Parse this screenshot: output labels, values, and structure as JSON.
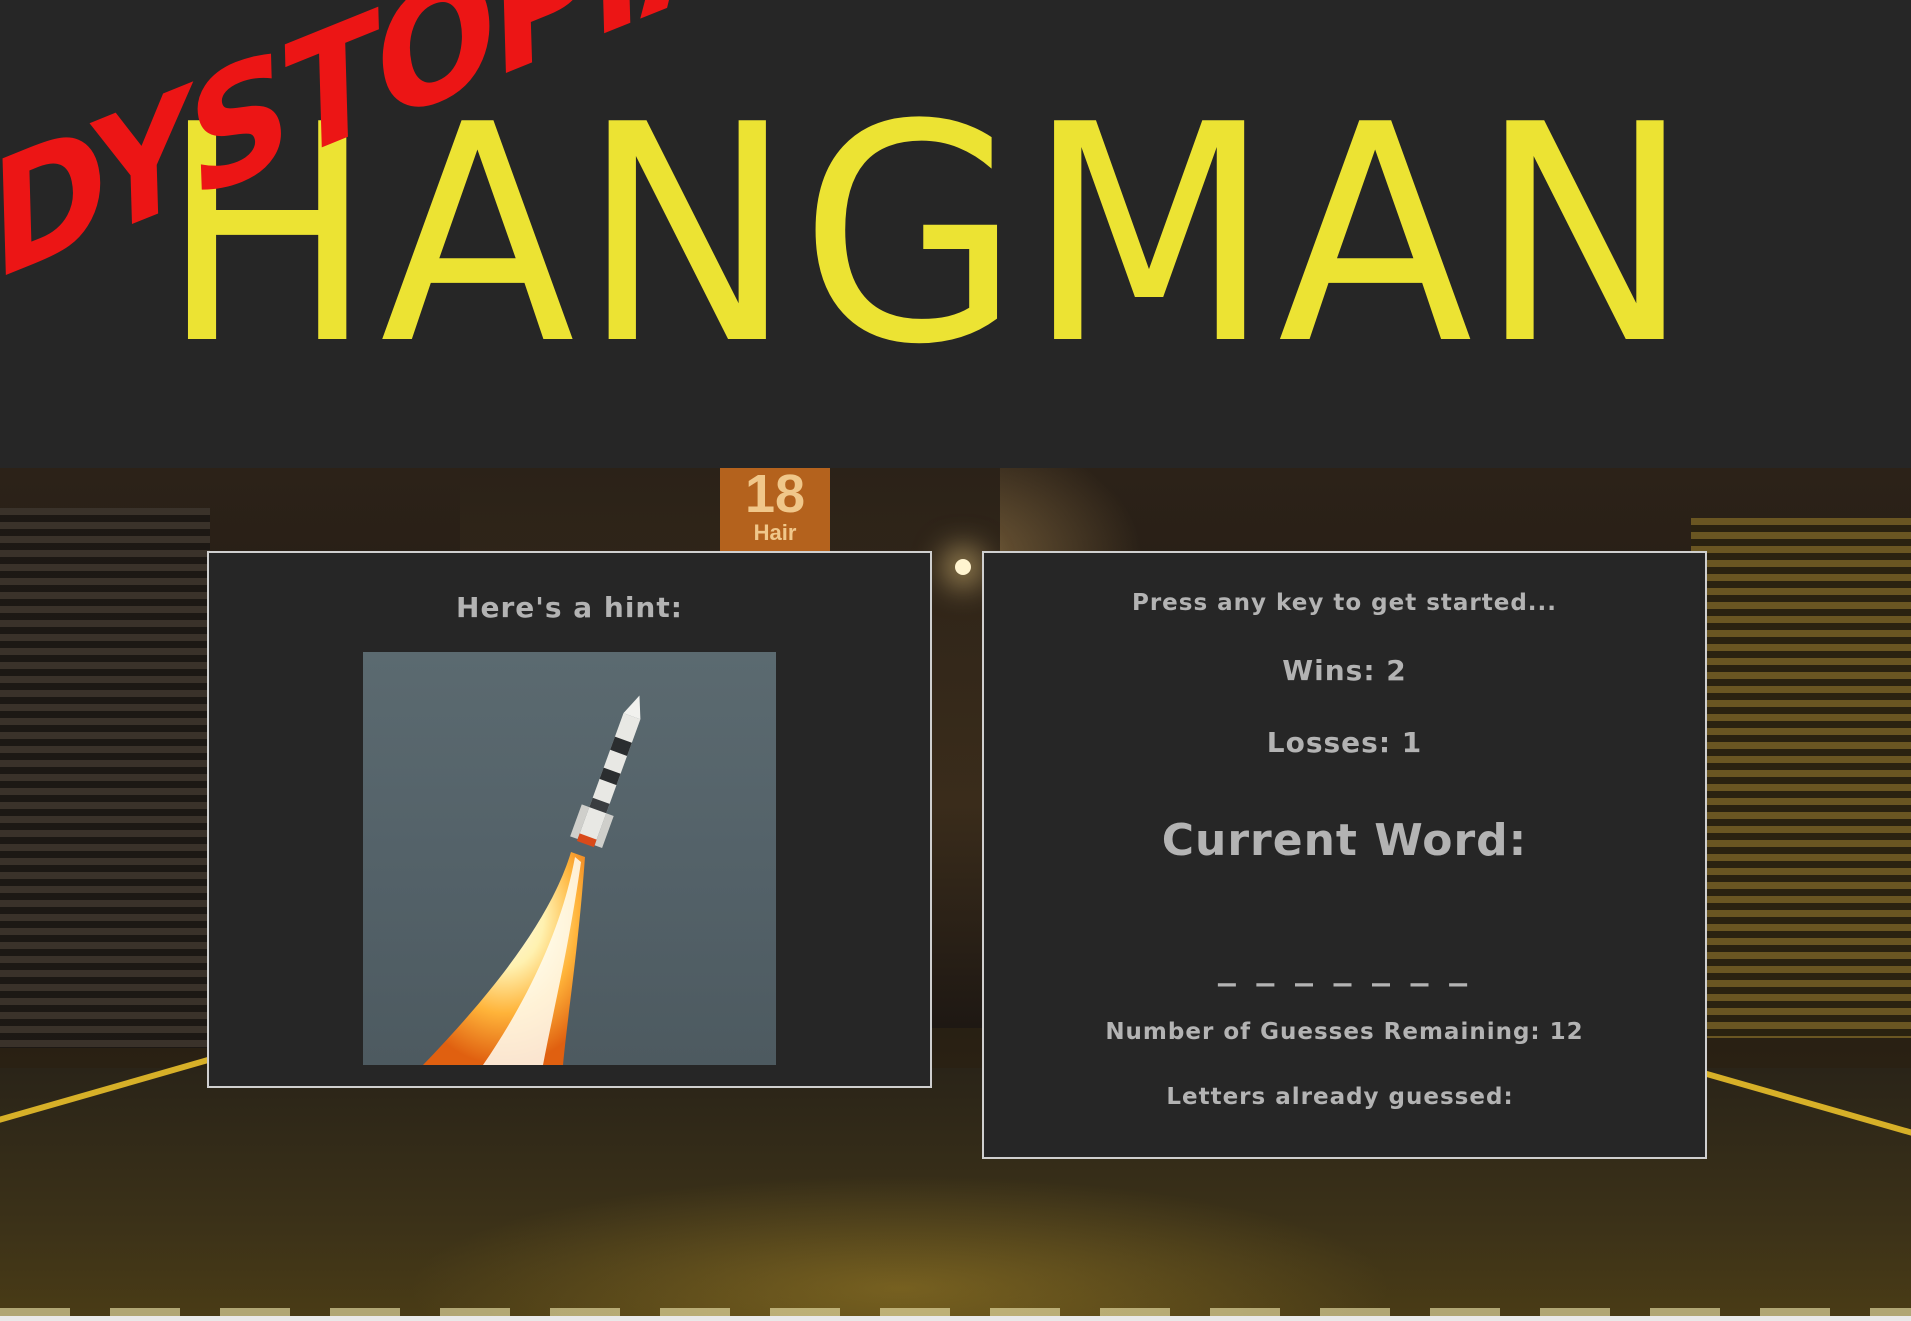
{
  "header": {
    "title": "HANGMAN",
    "overlay_word": "DYSTOPIA",
    "title_color": "#ece333",
    "overlay_color": "#ec1515",
    "background_color": "#262626"
  },
  "background": {
    "shop_sign_number": "18",
    "shop_sign_word": "Hair"
  },
  "hint_panel": {
    "label": "Here's a hint:",
    "image_icon": "rocket-launch-image"
  },
  "status_panel": {
    "start_prompt": "Press any key to get started...",
    "wins_label": "Wins:",
    "wins_value": "2",
    "losses_label": "Losses:",
    "losses_value": "1",
    "current_word_label": "Current Word:",
    "current_word_value": "_ _ _ _ _ _ _",
    "guesses_label": "Number of Guesses Remaining:",
    "guesses_value": "12",
    "letters_label": "Letters already guessed:",
    "letters_value": ""
  },
  "colors": {
    "panel_text": "#b3b3b3",
    "panel_border": "#cfcfcf",
    "panel_background": "#262626"
  }
}
